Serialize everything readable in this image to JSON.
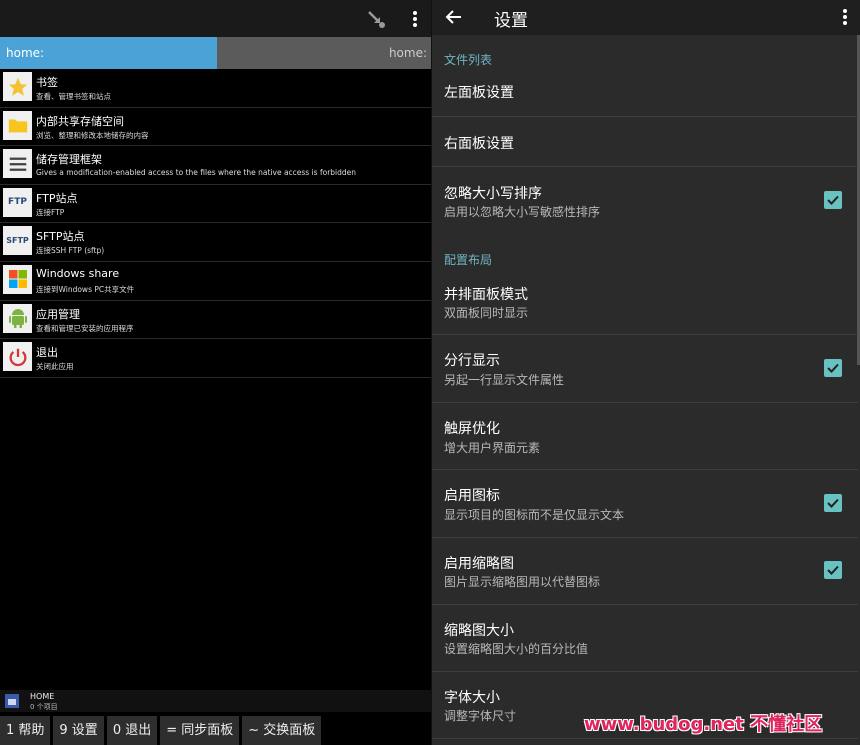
{
  "left": {
    "path_active": "home:",
    "path_right": "home:",
    "items": [
      {
        "title": "书签",
        "subtitle": "查看、管理书签和站点",
        "icon": "star-icon"
      },
      {
        "title": "内部共享存储空间",
        "subtitle": "浏览、整理和修改本地储存的内容",
        "icon": "folder-icon"
      },
      {
        "title": "储存管理框架",
        "subtitle": "Gives a modification-enabled access to the files where the native access is forbidden",
        "icon": "list-icon"
      },
      {
        "title": "FTP站点",
        "subtitle": "连接FTP",
        "icon": "ftp-icon",
        "badge": "FTP"
      },
      {
        "title": "SFTP站点",
        "subtitle": "连接SSH FTP (sftp)",
        "icon": "sftp-icon",
        "badge": "SFTP"
      },
      {
        "title": "Windows share",
        "subtitle": "连接到Windows PC共享文件",
        "icon": "windows-icon"
      },
      {
        "title": "应用管理",
        "subtitle": "查看和管理已安装的应用程序",
        "icon": "android-icon"
      },
      {
        "title": "退出",
        "subtitle": "关闭此应用",
        "icon": "power-icon"
      }
    ],
    "status": {
      "title": "HOME",
      "subtitle": "0 个项目"
    },
    "fkeys": [
      "1 帮助",
      "9 设置",
      "0 退出",
      "= 同步面板",
      "~ 交换面板"
    ]
  },
  "right": {
    "title": "设置",
    "section1": "文件列表",
    "section2": "配置布局",
    "prefs": [
      {
        "title": "左面板设置",
        "subtitle": "",
        "checked": false
      },
      {
        "title": "右面板设置",
        "subtitle": "",
        "checked": false
      },
      {
        "title": "忽略大小写排序",
        "subtitle": "启用以忽略大小写敏感性排序",
        "checked": true
      },
      {
        "title": "并排面板模式",
        "subtitle": "双面板同时显示",
        "checked": false
      },
      {
        "title": "分行显示",
        "subtitle": "另起一行显示文件属性",
        "checked": true
      },
      {
        "title": "触屏优化",
        "subtitle": "增大用户界面元素",
        "checked": false
      },
      {
        "title": "启用图标",
        "subtitle": "显示项目的图标而不是仅显示文本",
        "checked": true
      },
      {
        "title": "启用缩略图",
        "subtitle": "图片显示缩略图用以代替图标",
        "checked": true
      },
      {
        "title": "缩略图大小",
        "subtitle": "设置缩略图大小的百分比值",
        "checked": false
      },
      {
        "title": "字体大小",
        "subtitle": "调整字体尺寸",
        "checked": false
      }
    ]
  },
  "watermark": "www.budog.net 不懂社区",
  "colors": {
    "path_active": "#4aa2d6",
    "accent": "#6fb6c2",
    "checkbox": "#69c2c2"
  }
}
